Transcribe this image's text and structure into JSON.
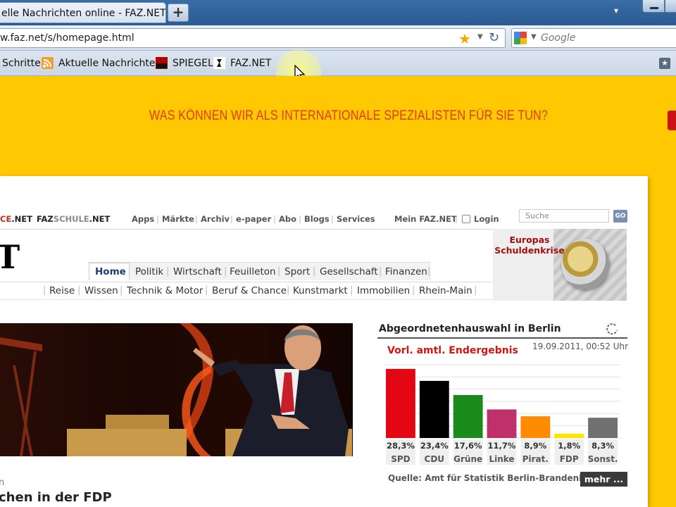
{
  "browser": {
    "tab_title": "elle Nachrichten online - FAZ.NET",
    "new_tab_label": "+",
    "url": "w.faz.net/s/homepage.html",
    "search_placeholder": "Google",
    "bookmarks": [
      {
        "label": "Schritte",
        "icon": ""
      },
      {
        "label": "Aktuelle Nachrichten",
        "icon": "rss-icon"
      },
      {
        "label": "SPIEGEL",
        "icon": "spiegel-icon"
      },
      {
        "label": "FAZ.NET",
        "icon": "faz-icon"
      }
    ]
  },
  "ad": {
    "text": "WAS KÖNNEN WIR ALS INTERNATIONALE SPEZIALISTEN FÜR SIE TUN?"
  },
  "site": {
    "top_links_left": [
      {
        "a": "CE",
        "b": ".NET"
      },
      {
        "a": "FAZ",
        "b": "SCHULE",
        "c": ".NET"
      }
    ],
    "top_links": [
      "Apps",
      "Märkte",
      "Archiv",
      "e-paper",
      "Abo",
      "Blogs",
      "Services"
    ],
    "my_faz": "Mein FAZ.NET",
    "login": "Login",
    "search_placeholder": "Suche",
    "search_button": "GO",
    "logo_fragment": "T",
    "promo_text": "Europas Schuldenkrise",
    "main_nav": [
      "Home",
      "Politik",
      "Wirtschaft",
      "Feuilleton",
      "Sport",
      "Gesellschaft",
      "Finanzen"
    ],
    "sub_nav": [
      "Reise",
      "Wissen",
      "Technik & Motor",
      "Beruf & Chance",
      "Kunstmarkt",
      "Immobilien",
      "Rhein-Main"
    ],
    "headline_kicker": "n",
    "headline": "chen in der FDP"
  },
  "election": {
    "title": "Abgeordnetenhauswahl in Berlin",
    "subtitle": "Vorl. amtl. Endergebnis",
    "date": "19.09.2011, 00:52 Uhr",
    "source": "Quelle: Amt für Statistik Berlin-Brandenburg",
    "more": "mehr ..."
  },
  "chart_data": {
    "type": "bar",
    "title": "Vorl. amtl. Endergebnis",
    "categories": [
      "SPD",
      "CDU",
      "Grüne",
      "Linke",
      "Pirat.",
      "FDP",
      "Sonst."
    ],
    "values": [
      28.3,
      23.4,
      17.6,
      11.7,
      8.9,
      1.8,
      8.3
    ],
    "value_labels": [
      "28,3%",
      "23,4%",
      "17,6%",
      "11,7%",
      "8,9%",
      "1,8%",
      "8,3%"
    ],
    "colors": [
      "#e30613",
      "#000000",
      "#1a8a1a",
      "#c0306a",
      "#ff8c00",
      "#ffe600",
      "#707070"
    ],
    "ylim": [
      0,
      30
    ],
    "grid": true
  }
}
